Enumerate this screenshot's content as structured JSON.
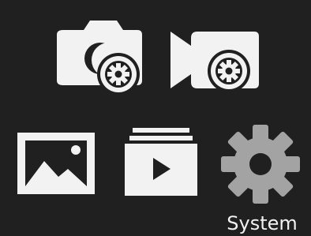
{
  "menu": {
    "selected_label": "System",
    "items": [
      {
        "id": "photo",
        "icon": "camera-settings-icon",
        "selected": false
      },
      {
        "id": "video",
        "icon": "video-settings-icon",
        "selected": false
      },
      {
        "id": "gallery",
        "icon": "image-gallery-icon",
        "selected": false
      },
      {
        "id": "playback",
        "icon": "playback-icon",
        "selected": false
      },
      {
        "id": "system",
        "icon": "gear-icon",
        "selected": true
      }
    ]
  },
  "colors": {
    "background": "#202020",
    "icon_default": "#f2f2f2",
    "icon_selected": "#a3a3a3",
    "label_text": "#f2f2f2"
  }
}
